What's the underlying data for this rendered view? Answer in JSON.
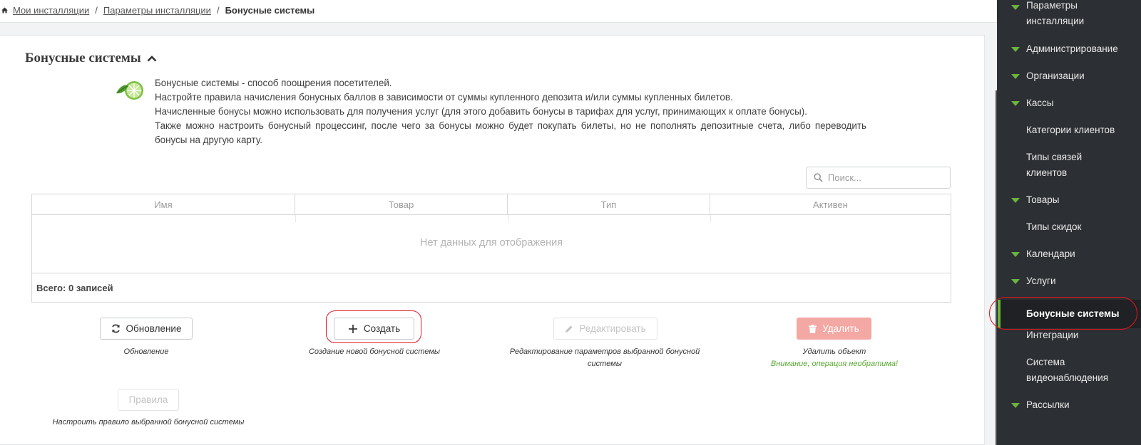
{
  "breadcrumb": {
    "items": [
      "Мои инсталляции",
      "Параметры инсталляции"
    ],
    "separator": "/",
    "current": "Бонусные системы"
  },
  "section": {
    "title": "Бонусные системы",
    "description": [
      "Бонусные системы - способ поощрения посетителей.",
      "Настройте правила начисления бонусных баллов в зависимости от суммы купленного депозита и/или суммы купленных билетов.",
      "Начисленные бонусы можно использовать для получения услуг (для этого добавить бонусы в тарифах для услуг, принимающих к оплате бонусы).",
      "Также можно настроить бонусный процессинг, после чего за бонусы можно будет покупать билеты, но не пополнять депозитные счета, либо переводить бонусы на другую карту."
    ]
  },
  "search": {
    "placeholder": "Поиск..."
  },
  "grid": {
    "columns": [
      "Имя",
      "Товар",
      "Тип",
      "Активен"
    ],
    "empty_text": "Нет данных для отображения",
    "footer": "Всего: 0 записей"
  },
  "actions": {
    "refresh": {
      "label": "Обновление",
      "hint": "Обновление"
    },
    "create": {
      "label": "Создать",
      "hint": "Создание новой бонусной системы"
    },
    "edit": {
      "label": "Редактировать",
      "hint_line1": "Редактирование параметров выбранной бонусной",
      "hint_line2": "системы"
    },
    "delete": {
      "label": "Удалить",
      "hint": "Удалить объект",
      "warning": "Внимание, операция необратима!"
    },
    "rules": {
      "label": "Правила",
      "hint": "Настроить правило выбранной бонусной системы"
    }
  },
  "sidebar": {
    "items": [
      {
        "label_line1": "Параметры",
        "label_line2": "инсталляции",
        "expandable": true
      },
      {
        "label": "Администрирование",
        "expandable": true
      },
      {
        "label": "Организации",
        "expandable": true
      },
      {
        "label": "Кассы",
        "expandable": true
      },
      {
        "label": "Категории клиентов",
        "expandable": false
      },
      {
        "label_line1": "Типы связей",
        "label_line2": "клиентов",
        "expandable": false
      },
      {
        "label": "Товары",
        "expandable": true
      },
      {
        "label": "Типы скидок",
        "expandable": false
      },
      {
        "label": "Календари",
        "expandable": true
      },
      {
        "label": "Услуги",
        "expandable": true
      },
      {
        "label": "Бонусные системы",
        "expandable": false,
        "active": true
      },
      {
        "label": "Интеграции",
        "expandable": false
      },
      {
        "label_line1": "Система",
        "label_line2": "видеонаблюдения",
        "expandable": false
      },
      {
        "label": "Рассылки",
        "expandable": true
      }
    ]
  },
  "colors": {
    "accent": "#6cb33f",
    "sidebar_bg": "#2c2f33",
    "danger": "#f3a8a4",
    "highlight_ring": "#e0171f"
  },
  "icons": [
    "home-icon",
    "caret-up-icon",
    "lime-icon",
    "search-icon",
    "refresh-icon",
    "plus-icon",
    "pencil-icon",
    "trash-icon",
    "expand-triangle-icon"
  ]
}
